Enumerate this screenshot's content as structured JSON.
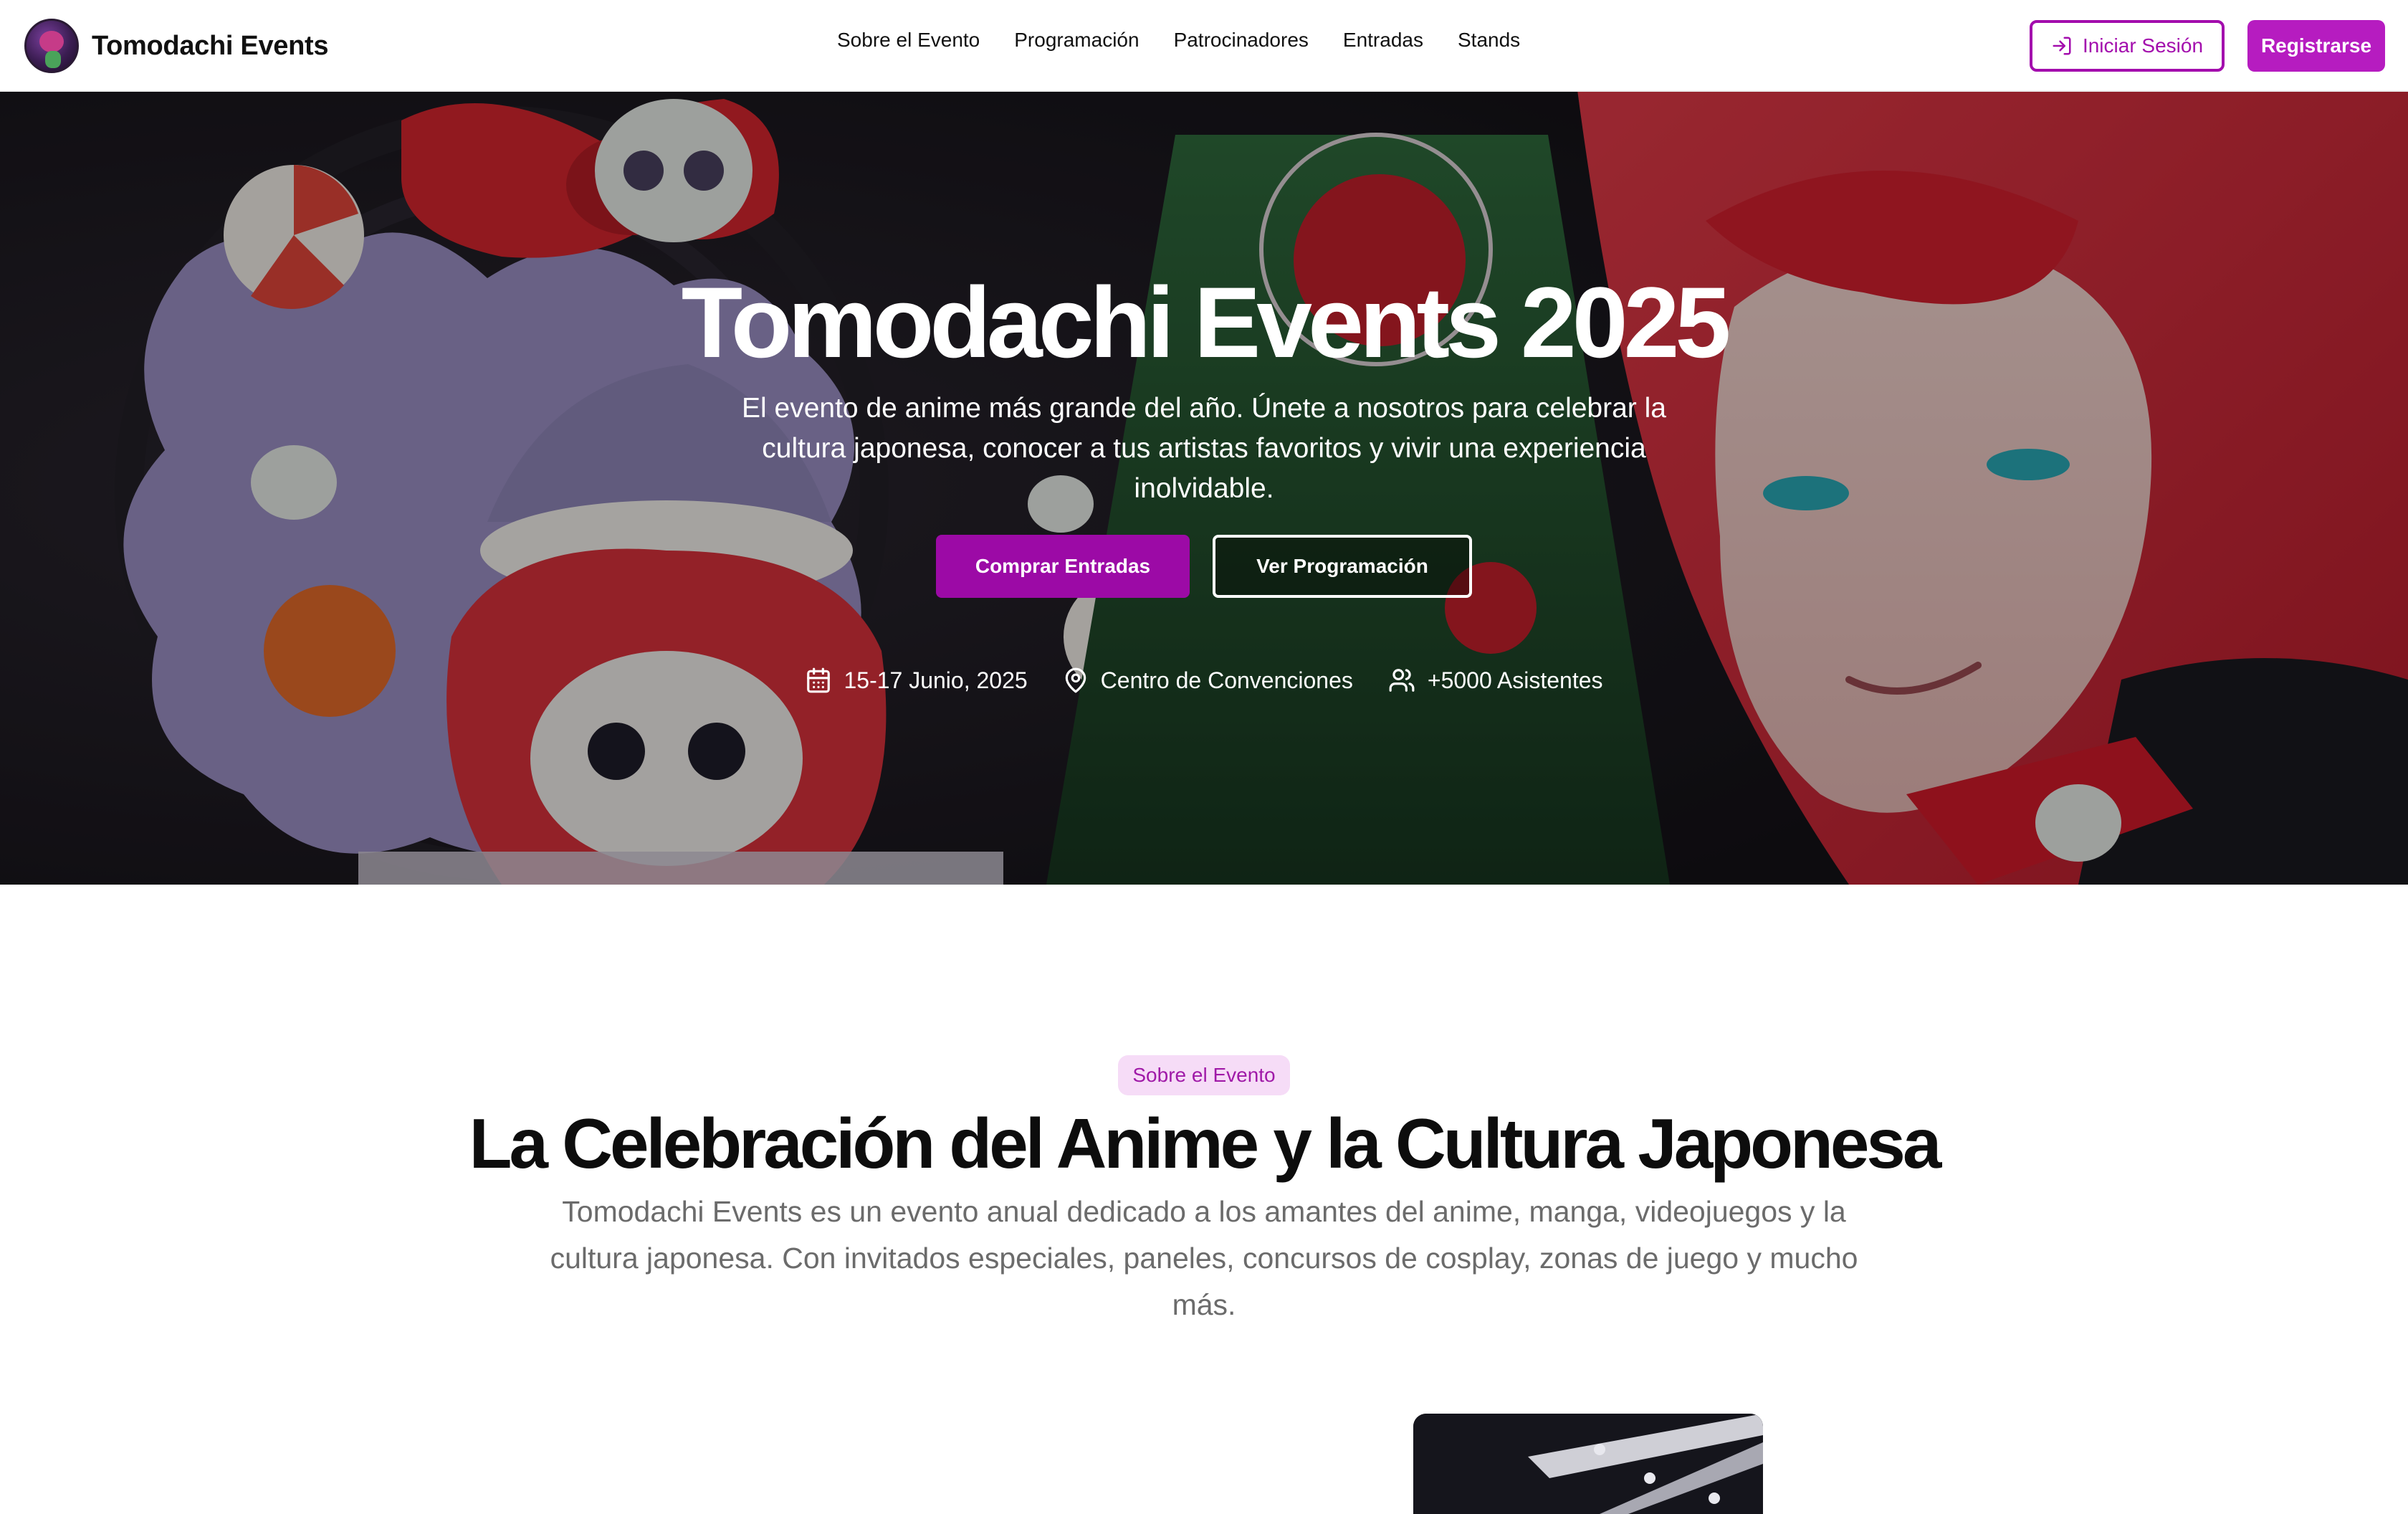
{
  "brand": {
    "name": "Tomodachi Events"
  },
  "nav": {
    "links": [
      "Sobre el Evento",
      "Programación",
      "Patrocinadores",
      "Entradas",
      "Stands"
    ],
    "login_label": "Iniciar Sesión",
    "register_label": "Registrarse"
  },
  "hero": {
    "title": "Tomodachi Events 2025",
    "subtitle": "El evento de anime más grande del año. Únete a nosotros para celebrar la cultura japonesa, conocer a tus artistas favoritos y vivir una experiencia inolvidable.",
    "buy_label": "Comprar Entradas",
    "schedule_label": "Ver Programación",
    "meta": {
      "date": "15-17 Junio, 2025",
      "location": "Centro de Convenciones",
      "attendees": "+5000 Asistentes"
    }
  },
  "about": {
    "pill": "Sobre el Evento",
    "title": "La Celebración del Anime y la Cultura Japonesa",
    "text": "Tomodachi Events es un evento anual dedicado a los amantes del anime, manga, videojuegos y la cultura japonesa. Con invitados especiales, paneles, concursos de cosplay, zonas de juego y mucho más."
  },
  "colors": {
    "accent": "#b61cc0",
    "accent_dark": "#9c0aa6",
    "pill_bg": "#f6dcf7"
  },
  "icons": [
    "log-in-icon",
    "calendar-icon",
    "map-pin-icon",
    "users-icon"
  ]
}
